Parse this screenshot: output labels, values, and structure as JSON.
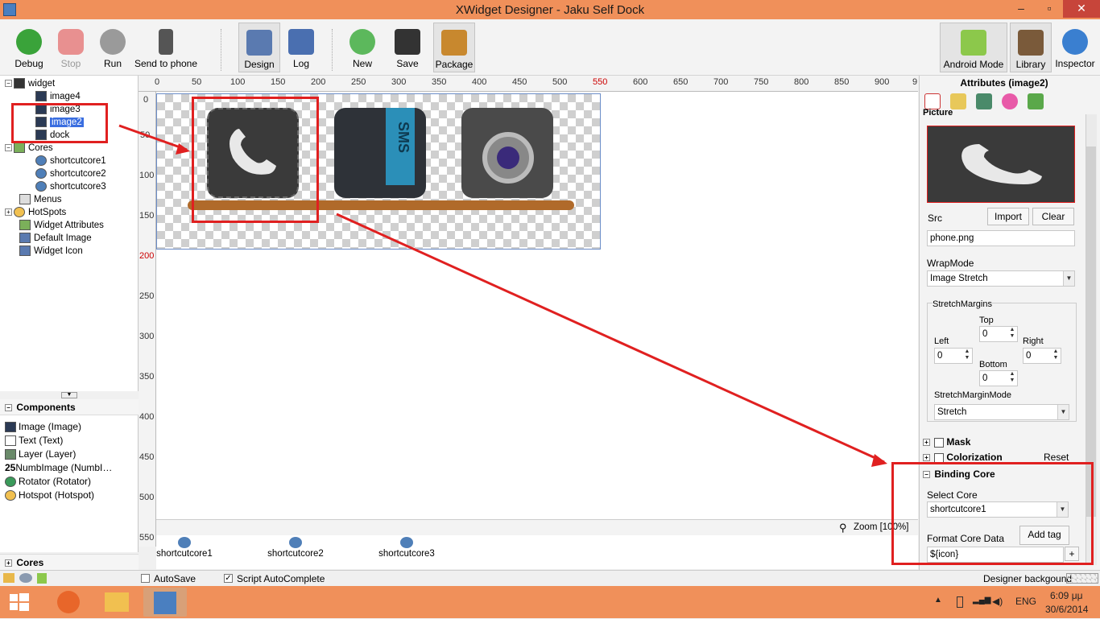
{
  "window": {
    "title": "XWidget Designer - Jaku Self Dock",
    "min": "–",
    "max": "▫",
    "close": "✕"
  },
  "toolbar": {
    "debug": "Debug",
    "stop": "Stop",
    "run": "Run",
    "send": "Send to phone",
    "design": "Design",
    "log": "Log",
    "new": "New",
    "save": "Save",
    "package": "Package",
    "android_mode": "Android Mode",
    "library": "Library",
    "inspector": "Inspector"
  },
  "tree": {
    "root": "widget",
    "images": [
      "image4",
      "image3",
      "image2",
      "dock"
    ],
    "cores_label": "Cores",
    "cores": [
      "shortcutcore1",
      "shortcutcore2",
      "shortcutcore3"
    ],
    "menus": "Menus",
    "hotspots": "HotSpots",
    "widget_attributes": "Widget Attributes",
    "default_image": "Default Image",
    "widget_icon": "Widget Icon"
  },
  "components": {
    "header": "Components",
    "items": [
      "Image (Image)",
      "Text (Text)",
      "Layer (Layer)",
      "NumbImage (NumbI…",
      "Rotator (Rotator)",
      "Hotspot (Hotspot)"
    ],
    "numb_prefix": "25",
    "cores_bar": "Cores"
  },
  "ruler": {
    "h": [
      "0",
      "50",
      "100",
      "150",
      "200",
      "250",
      "300",
      "350",
      "400",
      "450",
      "500",
      "550",
      "600",
      "650",
      "700",
      "750",
      "800",
      "850",
      "900",
      "9"
    ],
    "v": [
      "0",
      "50",
      "100",
      "150",
      "200",
      "250",
      "300",
      "350",
      "400",
      "450",
      "500",
      "550"
    ]
  },
  "canvas": {
    "sms_label": "SMS",
    "zoom": "Zoom [100%]"
  },
  "core_bar": [
    "shortcutcore1",
    "shortcutcore2",
    "shortcutcore3"
  ],
  "attributes": {
    "header": "Attributes (image2)",
    "picture_section": "Picture",
    "src_label": "Src",
    "import": "Import",
    "clear": "Clear",
    "src_value": "phone.png",
    "wrapmode_label": "WrapMode",
    "wrapmode_value": "Image Stretch",
    "stretch_margins": "StretchMargins",
    "top": "Top",
    "left": "Left",
    "right": "Right",
    "bottom": "Bottom",
    "top_val": "0",
    "left_val": "0",
    "right_val": "0",
    "bottom_val": "0",
    "margin_mode_label": "StretchMarginMode",
    "margin_mode_value": "Stretch",
    "mask": "Mask",
    "colorization": "Colorization",
    "reset": "Reset",
    "binding_core": "Binding Core",
    "select_core": "Select Core",
    "select_core_value": "shortcutcore1",
    "format_core_data": "Format Core Data",
    "add_tag": "Add tag",
    "format_value": "${icon}"
  },
  "status": {
    "autosave": "AutoSave",
    "script_autocomplete": "Script AutoComplete",
    "designer_background": "Designer backgound"
  },
  "taskbar": {
    "lang": "ENG",
    "time": "6:09 μμ",
    "date": "30/6/2014"
  },
  "colors": {
    "accent": "#f0905a",
    "selection": "#3a6ee0",
    "highlight": "#e02020"
  }
}
